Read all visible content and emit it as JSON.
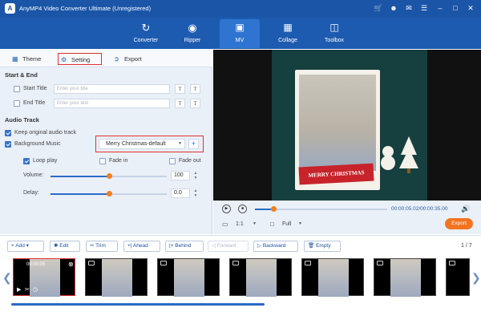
{
  "app": {
    "title": "AnyMP4 Video Converter Ultimate (Unregistered)"
  },
  "nav": [
    {
      "label": "Converter"
    },
    {
      "label": "Ripper"
    },
    {
      "label": "MV"
    },
    {
      "label": "Collage"
    },
    {
      "label": "Toolbox"
    }
  ],
  "tabs": {
    "theme": "Theme",
    "setting": "Setting",
    "export": "Export"
  },
  "start_end": {
    "heading": "Start & End",
    "start_title_label": "Start Title",
    "start_title_placeholder": "Enter your title",
    "end_title_label": "End Title",
    "end_title_placeholder": "Enter your text"
  },
  "audio": {
    "heading": "Audio Track",
    "keep_original": "Keep original audio track",
    "background_music": "Background Music",
    "music_selected": "Merry Christmas-default",
    "loop_play": "Loop play",
    "fade_in": "Fade in",
    "fade_out": "Fade out",
    "volume_label": "Volume:",
    "volume_value": "100",
    "volume_level": 1.0,
    "delay_label": "Delay:",
    "delay_value": "0.0",
    "delay_level": 0.5
  },
  "preview": {
    "banner": "MERRY CHRISTMAS",
    "time": "00:00:05.02/00:00:35.00",
    "ratio": "1:1",
    "zoom": "Full",
    "progress": 0.14,
    "export_label": "Export"
  },
  "toolbar": {
    "add": "Add",
    "edit": "Edit",
    "trim": "Trim",
    "ahead": "Ahead",
    "behind": "Behind",
    "forward": "Forward",
    "backward": "Backward",
    "empty": "Empty",
    "page": "1 / 7"
  },
  "timeline": {
    "first_clip_time": "00:00:05"
  },
  "colors": {
    "accent": "#1d5bb0",
    "export": "#f37321",
    "highlight": "#e03030"
  }
}
